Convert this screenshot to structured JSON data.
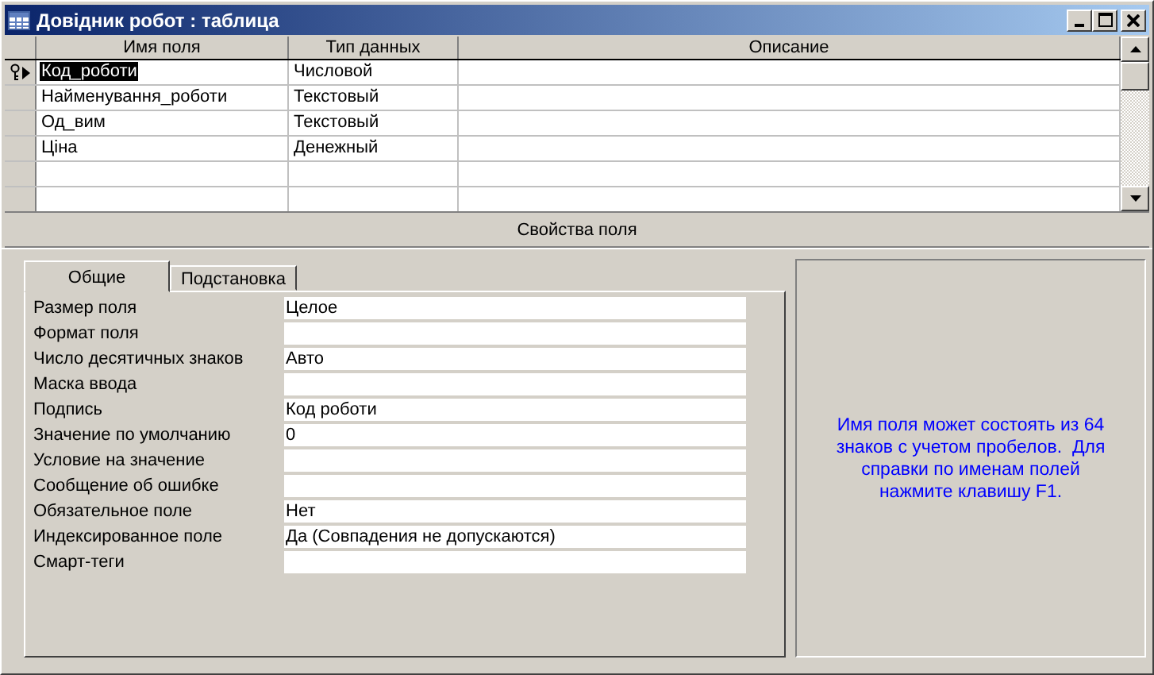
{
  "window": {
    "title": "Довідник робот : таблица"
  },
  "grid": {
    "columns": [
      "Имя поля",
      "Тип данных",
      "Описание"
    ],
    "rows": [
      {
        "name": "Код_роботи",
        "type": "Числовой",
        "selected": true,
        "primary_key": true
      },
      {
        "name": "Найменування_роботи",
        "type": "Текстовый",
        "selected": false,
        "primary_key": false
      },
      {
        "name": "Од_вим",
        "type": "Текстовый",
        "selected": false,
        "primary_key": false
      },
      {
        "name": "Ціна",
        "type": "Денежный",
        "selected": false,
        "primary_key": false
      }
    ]
  },
  "properties_label": "Свойства поля",
  "tabs": [
    {
      "label": "Общие",
      "selected": true
    },
    {
      "label": "Подстановка",
      "selected": false
    }
  ],
  "properties": [
    {
      "label": "Размер поля",
      "value": "Целое"
    },
    {
      "label": "Формат поля"
    },
    {
      "label": "Число десятичных знаков",
      "value": "Авто"
    },
    {
      "label": "Маска ввода"
    },
    {
      "label": "Подпись",
      "value": "Код роботи"
    },
    {
      "label": "Значение по умолчанию",
      "value": "0"
    },
    {
      "label": "Условие на значение"
    },
    {
      "label": "Сообщение об ошибке"
    },
    {
      "label": "Обязательное поле",
      "value": "Нет"
    },
    {
      "label": "Индексированное поле",
      "value": "Да (Совпадения не допускаются)"
    },
    {
      "label": "Смарт-теги"
    }
  ],
  "help_text": "Имя поля может состоять из 64 знаков с учетом пробелов.  Для справки по именам полей нажмите клавишу F1."
}
